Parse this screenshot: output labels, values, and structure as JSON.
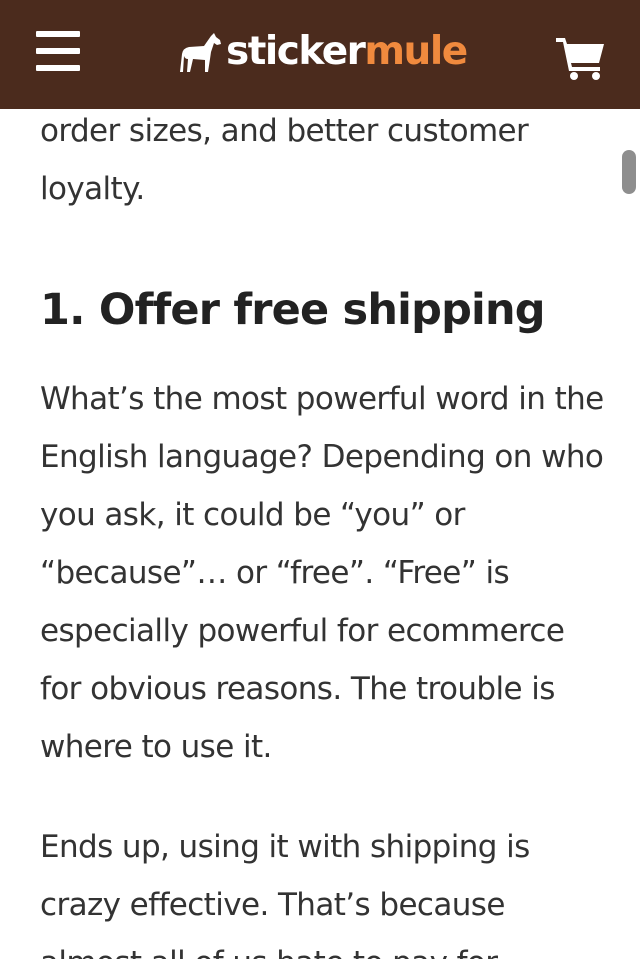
{
  "header": {
    "brand_part1": "sticker",
    "brand_part2": "mule",
    "background_color": "#4b2b1d",
    "accent_color": "#f08a3e",
    "menu_icon": "hamburger-menu-icon",
    "logo_icon": "mule-icon",
    "cart_icon": "shopping-cart-icon"
  },
  "article": {
    "intro_fragment": "order sizes, and better customer loyalty.",
    "heading": "1. Offer free shipping",
    "paragraph_1": "What’s the most powerful word in the English language? Depending on who you ask, it could be “you” or “because”… or “free”. “Free” is especially powerful for ecommerce for obvious reasons. The trouble is where to use it.",
    "paragraph_2": "Ends up, using it with shipping is crazy effective. That’s because almost all of us hate to pay for"
  }
}
